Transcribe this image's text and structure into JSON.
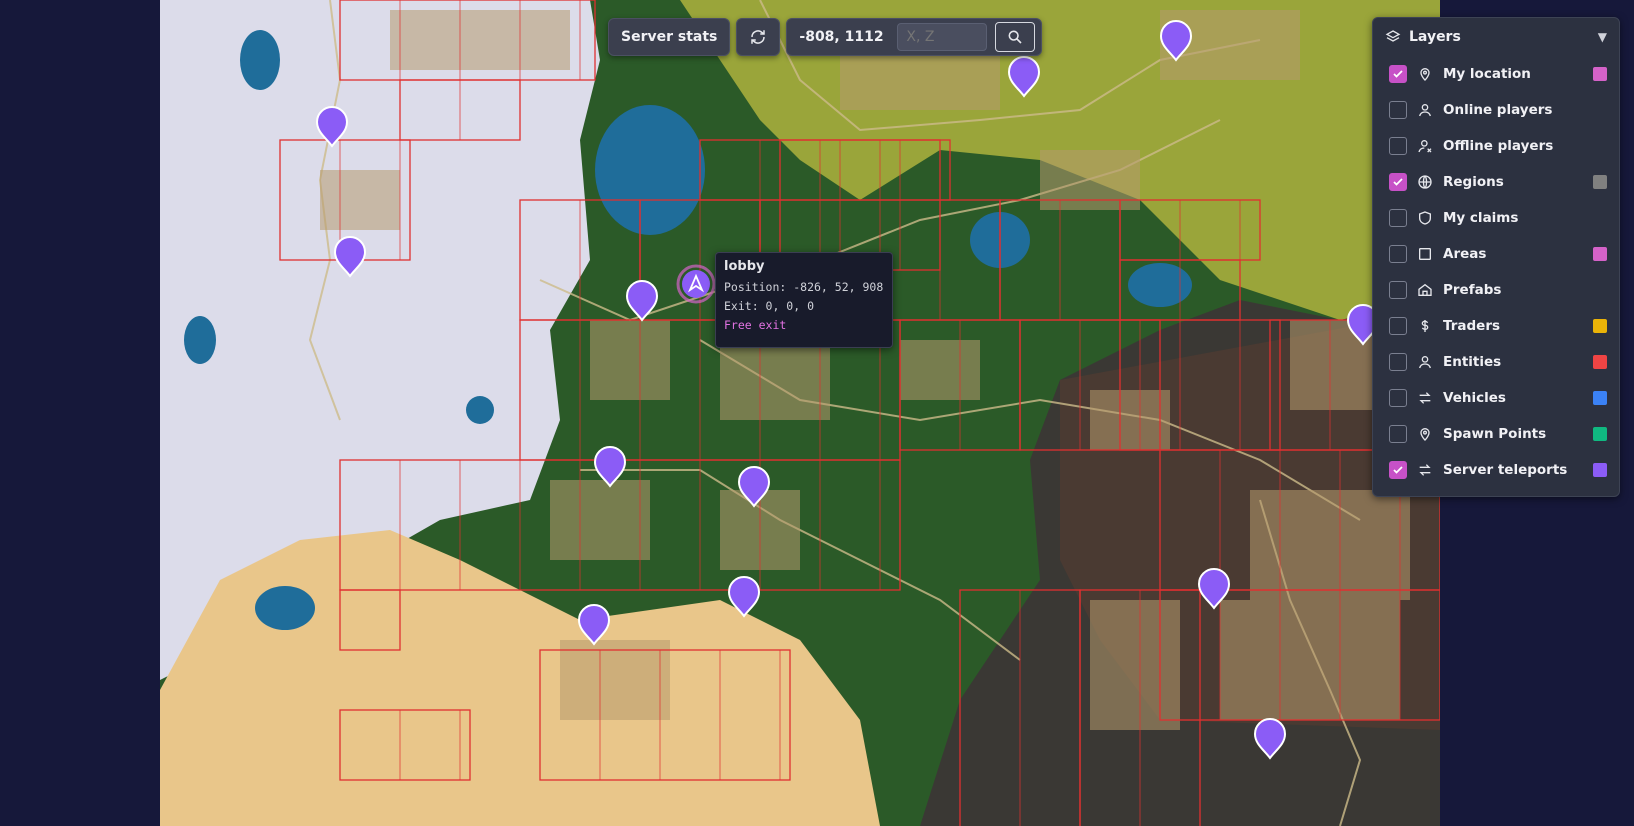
{
  "toolbar": {
    "server_stats_label": "Server stats",
    "current_coords": "-808, 1112",
    "coord_input_placeholder": "X, Z",
    "refresh_icon": "refresh-icon",
    "search_icon": "search-icon"
  },
  "layers_panel": {
    "title": "Layers",
    "icon": "layers-icon",
    "collapse_icon": "chevron-down-icon",
    "items": [
      {
        "label": "My location",
        "checked": true,
        "icon": "map-pin-icon",
        "color": "#d462c8"
      },
      {
        "label": "Online players",
        "checked": false,
        "icon": "user-icon",
        "color": ""
      },
      {
        "label": "Offline players",
        "checked": false,
        "icon": "user-offline-icon",
        "color": ""
      },
      {
        "label": "Regions",
        "checked": true,
        "icon": "globe-icon",
        "color": "#808080"
      },
      {
        "label": "My claims",
        "checked": false,
        "icon": "shield-icon",
        "color": ""
      },
      {
        "label": "Areas",
        "checked": false,
        "icon": "square-icon",
        "color": "#d462c8"
      },
      {
        "label": "Prefabs",
        "checked": false,
        "icon": "home-icon",
        "color": ""
      },
      {
        "label": "Traders",
        "checked": false,
        "icon": "dollar-icon",
        "color": "#eab308"
      },
      {
        "label": "Entities",
        "checked": false,
        "icon": "user-icon",
        "color": "#ef4444"
      },
      {
        "label": "Vehicles",
        "checked": false,
        "icon": "arrows-icon",
        "color": "#3b82f6"
      },
      {
        "label": "Spawn Points",
        "checked": false,
        "icon": "map-pin-icon",
        "color": "#10b981"
      },
      {
        "label": "Server teleports",
        "checked": true,
        "icon": "arrows-icon",
        "color": "#8b5cf6"
      }
    ]
  },
  "tooltip": {
    "title": "lobby",
    "position": "Position: -826, 52, 908",
    "exit": "Exit: 0, 0, 0",
    "link": "Free exit"
  },
  "map": {
    "teleport_marker_color": "#8b5cf6",
    "region_grid_color": "#e03030",
    "biomes": {
      "snow": "#dcdcea",
      "forest": "#2b5a28",
      "plains": "#9aa53a",
      "wasteland": "#3a3834",
      "burnt": "#4a3a32",
      "desert": "#e9c68a",
      "water": "#1f6d9a"
    }
  }
}
